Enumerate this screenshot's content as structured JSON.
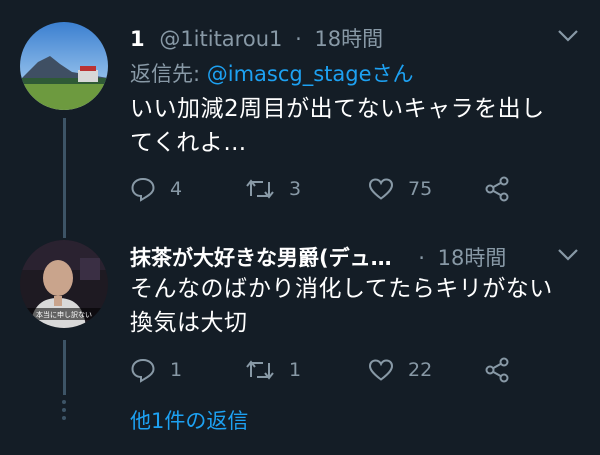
{
  "tweet1": {
    "display_name": "1",
    "handle": "@1ititarou1",
    "separator": "·",
    "time": "18時間",
    "reply_prefix": "返信先: ",
    "reply_to": "@imascg_stage",
    "reply_suffix": "さん",
    "text_line1": "いい加減2周目が出てないキャラを出し",
    "text_line2": "てくれよ…",
    "reply_count": "4",
    "retweet_count": "3",
    "like_count": "75"
  },
  "tweet2": {
    "display_name": "抹茶が大好きな男爵(デュ…",
    "separator": "·",
    "time": "18時間",
    "text_line1": "そんなのばかり消化してたらキリがない",
    "text_line2": "換気は大切",
    "reply_count": "1",
    "retweet_count": "1",
    "like_count": "22",
    "avatar_caption": "本当に申し訳ない"
  },
  "more_replies": "他1件の返信",
  "colors": {
    "background": "#141d26",
    "muted": "#8899a6",
    "accent": "#1da1f2",
    "thread_line": "#3d5466"
  },
  "icons": [
    "reply-icon",
    "retweet-icon",
    "like-icon",
    "share-icon",
    "chevron-down-icon"
  ]
}
